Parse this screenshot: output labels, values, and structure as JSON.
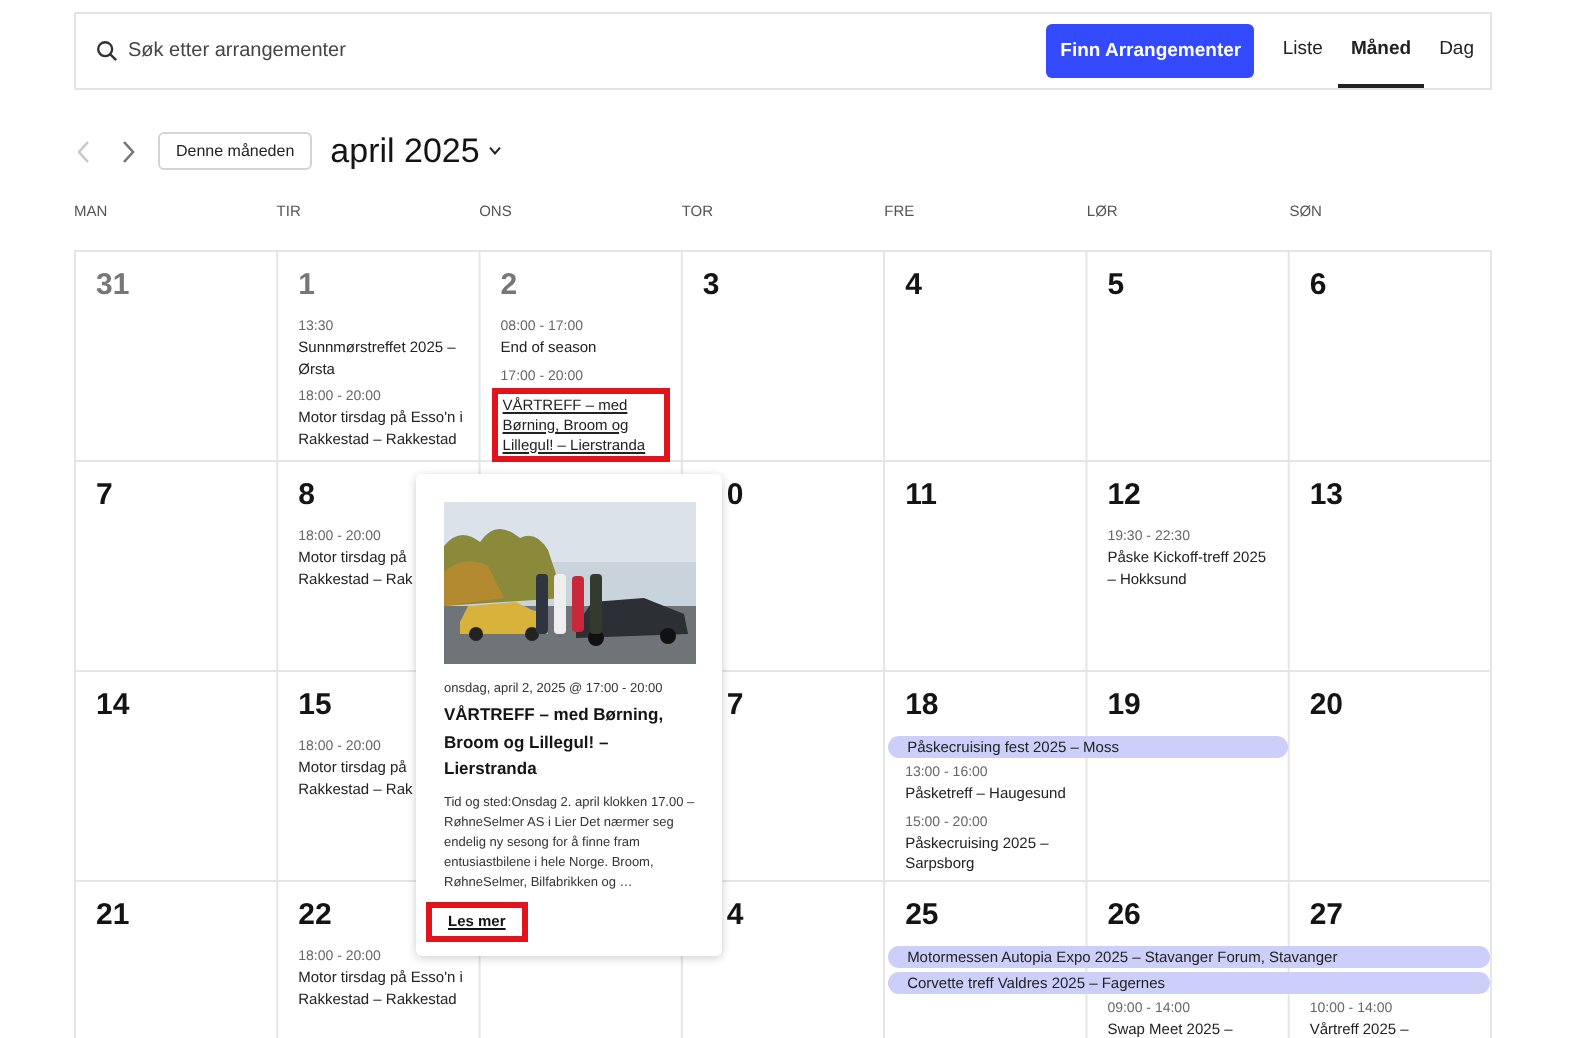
{
  "search": {
    "placeholder": "Søk etter arrangementer",
    "button": "Finn Arrangementer"
  },
  "views": [
    {
      "label": "Liste",
      "selected": false
    },
    {
      "label": "Måned",
      "selected": true
    },
    {
      "label": "Dag",
      "selected": false
    }
  ],
  "nav": {
    "today_button": "Denne måneden",
    "month": "april 2025"
  },
  "weekdays": [
    "MAN",
    "TIR",
    "ONS",
    "TOR",
    "FRE",
    "LØR",
    "SØN"
  ],
  "weeks": [
    {
      "days": [
        {
          "kind": "day",
          "day": "31",
          "past": true
        },
        {
          "kind": "day",
          "day": "1",
          "past": true,
          "events": [
            {
              "time": "13:30",
              "title": "Sunnmørstreffet 2025 – Ørsta",
              "highlighted": false
            },
            {
              "time": "18:00 - 20:00",
              "title": "Motor tirsdag på Esso'n i Rakkestad – Rakkestad",
              "highlighted": false
            }
          ]
        },
        {
          "kind": "day",
          "day": "2",
          "past": true,
          "events": [
            {
              "time": "08:00 - 17:00",
              "title": "End of season",
              "highlighted": false
            },
            {
              "time": "17:00 - 20:00",
              "title": "VÅRTREFF – med Børning, Broom og Lillegul! – Lierstranda",
              "highlighted": true
            }
          ]
        },
        {
          "kind": "day",
          "day": "3",
          "past": false
        },
        {
          "kind": "day",
          "day": "4",
          "past": false
        },
        {
          "kind": "day",
          "day": "5",
          "past": false
        },
        {
          "kind": "day",
          "day": "6",
          "past": false
        }
      ]
    },
    {
      "days": [
        {
          "kind": "day",
          "day": "7",
          "past": false
        },
        {
          "kind": "day",
          "day": "8",
          "past": false,
          "events": [
            {
              "time": "18:00 - 20:00",
              "lines": [
                "Motor tirsdag på",
                "Rakkestad – Rak"
              ]
            }
          ]
        },
        {
          "kind": "covered"
        },
        {
          "kind": "clipped",
          "day": "0"
        },
        {
          "kind": "day",
          "day": "11",
          "past": false
        },
        {
          "kind": "day",
          "day": "12",
          "past": false,
          "events": [
            {
              "time": "19:30 - 22:30",
              "title": "Påske Kickoff-treff 2025 – Hokksund",
              "highlighted": false
            }
          ]
        },
        {
          "kind": "day",
          "day": "13",
          "past": false
        }
      ]
    },
    {
      "days": [
        {
          "kind": "day",
          "day": "14",
          "past": false
        },
        {
          "kind": "day",
          "day": "15",
          "past": false,
          "events": [
            {
              "time": "18:00 - 20:00",
              "lines": [
                "Motor tirsdag på",
                "Rakkestad – Rak"
              ]
            }
          ]
        },
        {
          "kind": "covered"
        },
        {
          "kind": "clipped",
          "day": "7"
        },
        {
          "kind": "day",
          "day": "18",
          "past": false,
          "bars": [
            {
              "kind": "start",
              "title": "Påskecruising fest 2025 – Moss"
            }
          ],
          "events": [
            {
              "time": "13:00 - 16:00",
              "title": "Påsketreff – Haugesund",
              "highlighted": false
            },
            {
              "time": "15:00 - 20:00",
              "title": "Påskecruising 2025 – Sarpsborg",
              "highlighted": false
            }
          ]
        },
        {
          "kind": "day",
          "day": "19",
          "past": false,
          "bars": [
            {
              "kind": "continue"
            }
          ]
        },
        {
          "kind": "day",
          "day": "20",
          "past": false
        }
      ]
    },
    {
      "days": [
        {
          "kind": "day",
          "day": "21",
          "past": false
        },
        {
          "kind": "day",
          "day": "22",
          "past": false,
          "events": [
            {
              "time": "18:00 - 20:00",
              "title": "Motor tirsdag på Esso'n i Rakkestad – Rakkestad",
              "highlighted": false
            }
          ]
        },
        {
          "kind": "covered"
        },
        {
          "kind": "clipped",
          "day": "4"
        },
        {
          "kind": "day",
          "day": "25",
          "past": false,
          "bars": [
            {
              "kind": "start",
              "title": "Motormessen Autopia Expo 2025 – Stavanger Forum, Stavanger"
            },
            {
              "kind": "start",
              "title": "Corvette treff Valdres 2025 – Fagernes"
            }
          ]
        },
        {
          "kind": "day",
          "day": "26",
          "past": false,
          "bars": [
            {
              "kind": "continue"
            },
            {
              "kind": "continue"
            }
          ],
          "events": [
            {
              "time": "09:00 - 14:00",
              "title": "Swap Meet 2025 –",
              "highlighted": false
            }
          ]
        },
        {
          "kind": "day",
          "day": "27",
          "past": false,
          "bars": [
            {
              "kind": "continue"
            },
            {
              "kind": "continue"
            }
          ],
          "events": [
            {
              "time": "10:00 - 14:00",
              "title": "Vårtreff 2025 –",
              "highlighted": false
            }
          ]
        }
      ]
    }
  ],
  "popup": {
    "date": "onsdag, april 2, 2025 @ 17:00 - 20:00",
    "title": "VÅRTREFF – med Børning, Broom og Lillegul! – Lierstranda",
    "excerpt": "Tid og sted:Onsdag 2. april klokken 17.00 – RøhneSelmer AS i Lier Det nærmer seg endelig ny sesong for å finne fram entusiastbilene i hele Norge. Broom, RøhneSelmer, Bilfabrikken og …",
    "link": "Les mer",
    "link_highlighted": true
  }
}
